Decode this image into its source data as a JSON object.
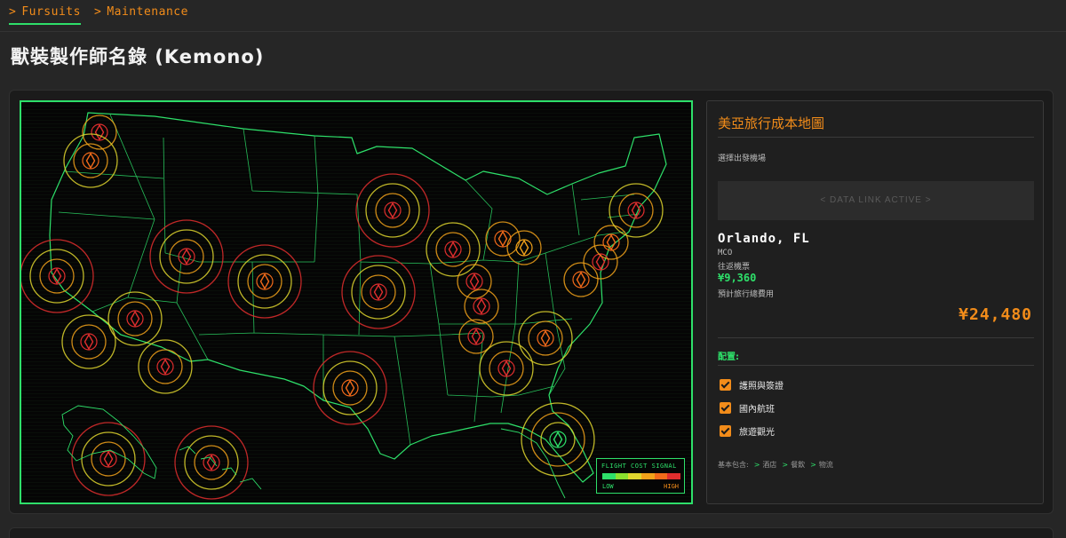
{
  "nav": {
    "crumbs": [
      "Fursuits",
      "Maintenance"
    ]
  },
  "page": {
    "title": "獸裝製作師名錄 (Kemono)"
  },
  "map": {
    "legend": {
      "title": "FLIGHT COST SIGNAL",
      "low": "LOW",
      "high": "HIGH",
      "colors": [
        "#2ee06a",
        "#8be02e",
        "#e0d62e",
        "#f2a21a",
        "#f26a1a",
        "#e02e2e"
      ]
    },
    "accent": "#2ee06a"
  },
  "sidebar": {
    "title": "美亞旅行成本地圖",
    "origin_label": "選擇出發機場",
    "datalink": "< DATA LINK ACTIVE >",
    "city": "Orlando, FL",
    "code": "MCO",
    "fare_label": "往返機票",
    "fare": "¥9,360",
    "total_label": "預計旅行總費用",
    "total": "¥24,480",
    "config_label": "配置:",
    "options": [
      {
        "label": "護照與簽證",
        "checked": true
      },
      {
        "label": "國內航班",
        "checked": true
      },
      {
        "label": "旅遊觀光",
        "checked": true
      }
    ],
    "includes_label": "基本包含:",
    "includes": [
      "酒店",
      "餐飲",
      "物流"
    ]
  }
}
